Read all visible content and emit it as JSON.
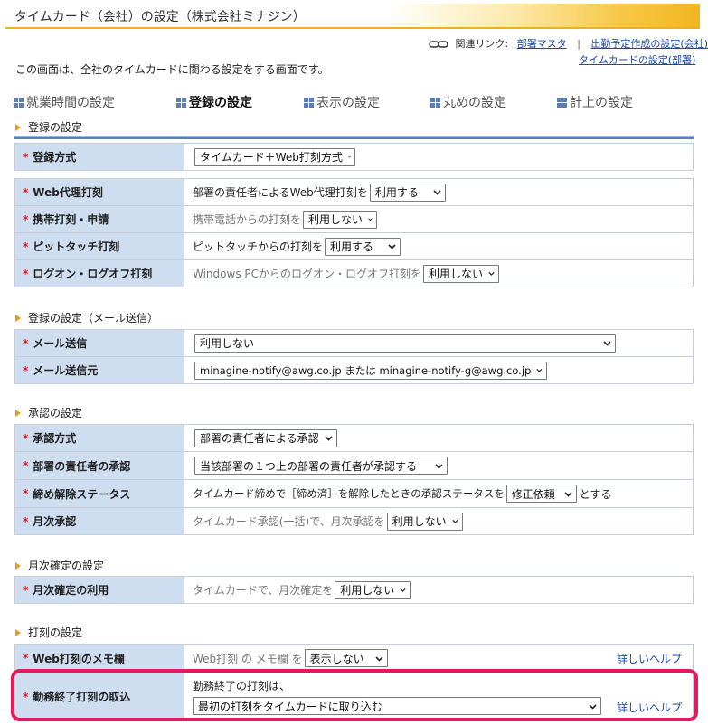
{
  "title": "タイムカード（会社）の設定（株式会社ミナジン）",
  "related": {
    "label": "関連リンク:",
    "links": [
      "部署マスタ",
      "出勤予定作成の設定(会社)",
      "タイムカードの設定(部署)"
    ]
  },
  "intro": "この画面は、全社のタイムカードに関わる設定をする画面です。",
  "tabs": [
    {
      "label": "就業時間の設定",
      "active": false
    },
    {
      "label": "登録の設定",
      "active": true
    },
    {
      "label": "表示の設定",
      "active": false
    },
    {
      "label": "丸めの設定",
      "active": false
    },
    {
      "label": "計上の設定",
      "active": false
    }
  ],
  "sections": {
    "register": "登録の設定",
    "mail": "登録の設定（メール送信）",
    "approval": "承認の設定",
    "monthly": "月次確定の設定",
    "stamp": "打刻の設定"
  },
  "rows": {
    "reg_method": {
      "label": "登録方式",
      "select": "タイムカード＋Web打刻方式"
    },
    "web_proxy": {
      "label": "Web代理打刻",
      "text": "部署の責任者によるWeb代理打刻を",
      "select": "利用する"
    },
    "mobile": {
      "label": "携帯打刻・申請",
      "text": "携帯電話からの打刻を",
      "select": "利用しない"
    },
    "pittouch": {
      "label": "ピットタッチ打刻",
      "text": "ピットタッチからの打刻を",
      "select": "利用する"
    },
    "logon": {
      "label": "ログオン・ログオフ打刻",
      "text": "Windows PCからのログオン・ログオフ打刻を",
      "select": "利用しない"
    },
    "mail_send": {
      "label": "メール送信",
      "select": "利用しない"
    },
    "mail_from": {
      "label": "メール送信元",
      "select": "minagine-notify@awg.co.jp または minagine-notify-g@awg.co.jp"
    },
    "approval_method": {
      "label": "承認方式",
      "select": "部署の責任者による承認"
    },
    "manager_approval": {
      "label": "部署の責任者の承認",
      "select": "当該部署の１つ上の部署の責任者が承認する"
    },
    "release_status": {
      "label": "締め解除ステータス",
      "text": "タイムカード締めで［締め済］を解除したときの承認ステータスを",
      "select": "修正依頼",
      "suffix": "とする"
    },
    "monthly_approval": {
      "label": "月次承認",
      "text": "タイムカード承認(一括)で、月次承認を",
      "select": "利用しない"
    },
    "monthly_fix": {
      "label": "月次確定の利用",
      "text": "タイムカードで、月次確定を",
      "select": "利用しない"
    },
    "web_memo": {
      "label": "Web打刻のメモ欄",
      "text": "Web打刻 の メモ欄 を",
      "select": "表示しない",
      "help": "詳しいヘルプ"
    },
    "end_import": {
      "label": "勤務終了打刻の取込",
      "text": "勤務終了の打刻は、",
      "select": "最初の打刻をタイムカードに取り込む",
      "help": "詳しいヘルプ"
    }
  },
  "colors": {
    "accent": "#f2b51f",
    "label_bg": "#cfddf0",
    "highlight": "#e5195f",
    "link": "#1b4aa8"
  }
}
